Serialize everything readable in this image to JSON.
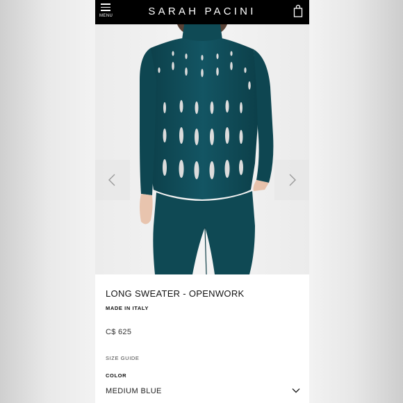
{
  "header": {
    "menu_label": "MENU",
    "brand": "SARAH PACINI",
    "menu_icon": "hamburger-icon",
    "bag_icon": "shopping-bag-icon",
    "background": "#000000"
  },
  "gallery": {
    "prev_icon": "chevron-left-icon",
    "next_icon": "chevron-right-icon",
    "product_color": "#0f4a55"
  },
  "product": {
    "name": "LONG SWEATER - OPENWORK",
    "origin": "MADE IN ITALY",
    "price": "C$ 625",
    "size_guide": "SIZE GUIDE",
    "color_label": "COLOR",
    "color_value": "MEDIUM BLUE",
    "color_dropdown_icon": "chevron-down-icon"
  }
}
